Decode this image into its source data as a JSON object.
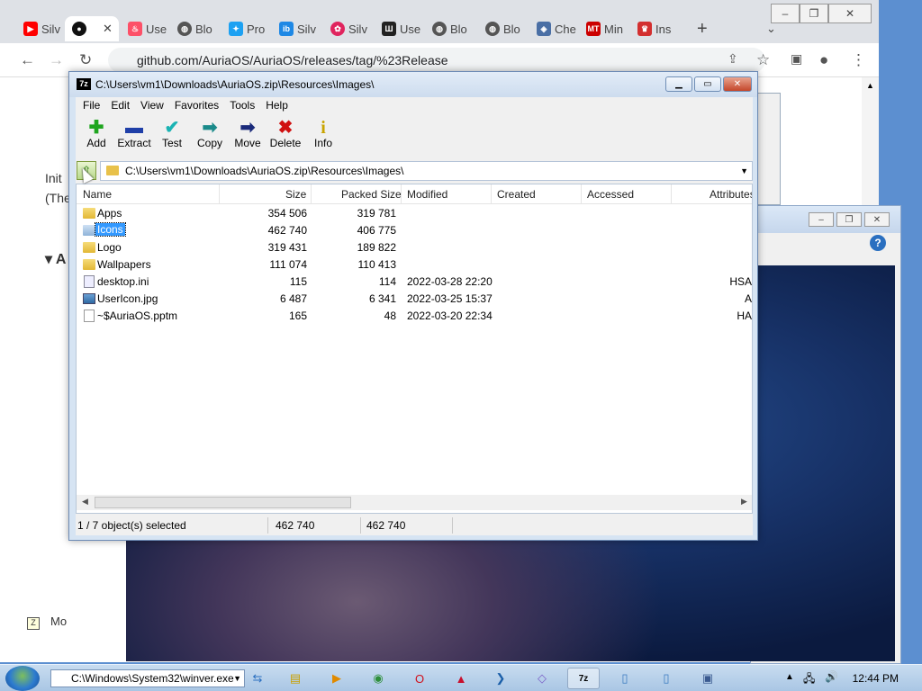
{
  "browser": {
    "tabs": [
      {
        "label": "Silv",
        "icon": "youtube-icon",
        "color": "#ff0000"
      },
      {
        "label": "",
        "icon": "github-icon",
        "color": "#000000",
        "active": true,
        "close": "✕"
      },
      {
        "label": "Use",
        "icon": "tinder-icon",
        "color": "#fd5068"
      },
      {
        "label": "Blo",
        "icon": "globe-icon",
        "color": "#555555"
      },
      {
        "label": "Pro",
        "icon": "twitter-icon",
        "color": "#1da1f2"
      },
      {
        "label": "Silv",
        "icon": "ibb-icon",
        "color": "#1e88e5"
      },
      {
        "label": "Silv",
        "icon": "pinwheel-icon",
        "color": "#e0245e"
      },
      {
        "label": "Use",
        "icon": "archive-icon",
        "color": "#222222"
      },
      {
        "label": "Blo",
        "icon": "globe-icon",
        "color": "#555555"
      },
      {
        "label": "Blo",
        "icon": "globe-icon",
        "color": "#555555"
      },
      {
        "label": "Che",
        "icon": "checker-icon",
        "color": "#4a6fa5"
      },
      {
        "label": "Min",
        "icon": "mt-icon",
        "color": "#cc0000"
      },
      {
        "label": "Ins",
        "icon": "ins-icon",
        "color": "#d32f2f"
      }
    ],
    "new_tab": "+",
    "url": "github.com/AuriaOS/AuriaOS/releases/tag/%23Release",
    "page_fragments": {
      "line1": "Init",
      "line2": "(The",
      "heading": "▾ A",
      "footer": "Mo"
    }
  },
  "sevenzip": {
    "title": "C:\\Users\\vm1\\Downloads\\AuriaOS.zip\\Resources\\Images\\",
    "app_icon": "7z",
    "menu": [
      "File",
      "Edit",
      "View",
      "Favorites",
      "Tools",
      "Help"
    ],
    "toolbar": [
      {
        "label": "Add",
        "icon": "add-icon",
        "glyph": "✚",
        "color": "#1fa51f"
      },
      {
        "label": "Extract",
        "icon": "extract-icon",
        "glyph": "▬",
        "color": "#1f3fa8"
      },
      {
        "label": "Test",
        "icon": "test-icon",
        "glyph": "✔",
        "color": "#1ab3b3"
      },
      {
        "label": "Copy",
        "icon": "copy-icon",
        "glyph": "➡",
        "color": "#1a8a8a"
      },
      {
        "label": "Move",
        "icon": "move-icon",
        "glyph": "➡",
        "color": "#1a2a7a"
      },
      {
        "label": "Delete",
        "icon": "delete-icon",
        "glyph": "✖",
        "color": "#d01010"
      },
      {
        "label": "Info",
        "icon": "info-icon",
        "glyph": "i",
        "color": "#c9a400"
      }
    ],
    "path": "C:\\Users\\vm1\\Downloads\\AuriaOS.zip\\Resources\\Images\\",
    "columns": [
      "Name",
      "Size",
      "Packed Size",
      "Modified",
      "Created",
      "Accessed",
      "Attributes"
    ],
    "rows": [
      {
        "name": "Apps",
        "type": "folder",
        "size": "354 506",
        "packed": "319 781",
        "modified": "",
        "attr": ""
      },
      {
        "name": "Icons",
        "type": "folder",
        "size": "462 740",
        "packed": "406 775",
        "modified": "",
        "attr": "",
        "selected": true
      },
      {
        "name": "Logo",
        "type": "folder",
        "size": "319 431",
        "packed": "189 822",
        "modified": "",
        "attr": ""
      },
      {
        "name": "Wallpapers",
        "type": "folder",
        "size": "111 074",
        "packed": "110 413",
        "modified": "",
        "attr": ""
      },
      {
        "name": "desktop.ini",
        "type": "ini",
        "size": "115",
        "packed": "114",
        "modified": "2022-03-28 22:20",
        "attr": "HSA"
      },
      {
        "name": "UserIcon.jpg",
        "type": "jpg",
        "size": "6 487",
        "packed": "6 341",
        "modified": "2022-03-25 15:37",
        "attr": "A"
      },
      {
        "name": "~$AuriaOS.pptm",
        "type": "file",
        "size": "165",
        "packed": "48",
        "modified": "2022-03-20 22:34",
        "attr": "HA"
      }
    ],
    "status": {
      "selection": "1 / 7 object(s) selected",
      "size": "462 740",
      "packed": "462 740"
    }
  },
  "taskbar": {
    "run_text": "C:\\Windows\\System32\\winver.exe",
    "clock": "12:44 PM",
    "apps": [
      "explorer-icon",
      "media-player-icon",
      "chrome-icon",
      "opera-icon",
      "acrobat-icon",
      "powershell-icon",
      "vs-icon",
      "7zip-icon",
      "notepad-icon",
      "document-icon",
      "window-icon"
    ]
  }
}
